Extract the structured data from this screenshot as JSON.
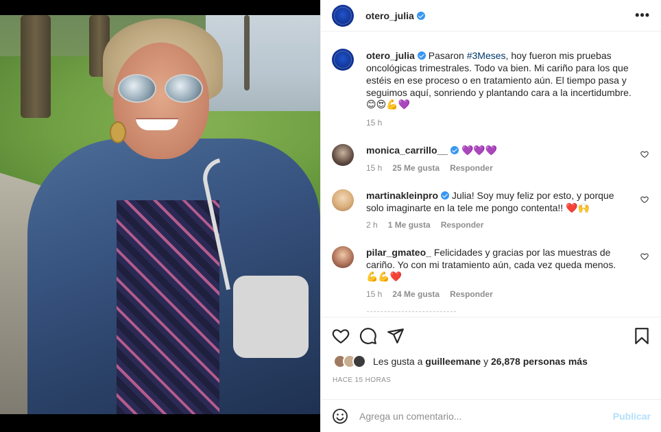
{
  "post": {
    "author": "otero_julia",
    "verified": true,
    "more_icon": "more-horizontal-icon",
    "caption": {
      "text_before": "Pasaron ",
      "hashtag": "#3Meses",
      "text_after": ", hoy fueron mis pruebas oncológicas trimestrales. Todo va bien. Mi cariño para los que estéis en ese proceso o en tratamiento aún. El tiempo pasa y seguimos aquí, sonriendo y plantando cara a la incertidumbre.",
      "emojis": "😊😍💪💜",
      "time": "15 h"
    }
  },
  "comments": [
    {
      "user": "monica_carrillo__",
      "verified": true,
      "text": "💜💜💜",
      "time": "15 h",
      "likes": "25 Me gusta",
      "reply": "Responder"
    },
    {
      "user": "martinakleinpro",
      "verified": true,
      "text": "Julia! Soy muy feliz por esto, y porque solo imaginarte en la tele me pongo contenta!! ❤️🙌",
      "time": "2 h",
      "likes": "1 Me gusta",
      "reply": "Responder"
    },
    {
      "user": "pilar_gmateo_",
      "verified": false,
      "text": "Felicidades y gracias por las muestras de cariño. Yo con mi tratamiento aún, cada vez queda menos.",
      "emojis": "💪💪❤️",
      "time": "15 h",
      "likes": "24 Me gusta",
      "reply": "Responder"
    }
  ],
  "actions": {
    "like_icon": "heart-icon",
    "comment_icon": "comment-icon",
    "share_icon": "paper-plane-icon",
    "save_icon": "bookmark-icon"
  },
  "likes": {
    "prefix": "Les gusta a ",
    "user": "guilleemane",
    "middle": " y ",
    "count": "26,878 personas más"
  },
  "timestamp": "Hace 15 horas",
  "comment_box": {
    "placeholder": "Agrega un comentario...",
    "publish_label": "Publicar"
  },
  "colors": {
    "verified": "#3897f0",
    "link": "#00376b",
    "publish_disabled": "#b2dffc",
    "muted": "#8e8e8e"
  }
}
